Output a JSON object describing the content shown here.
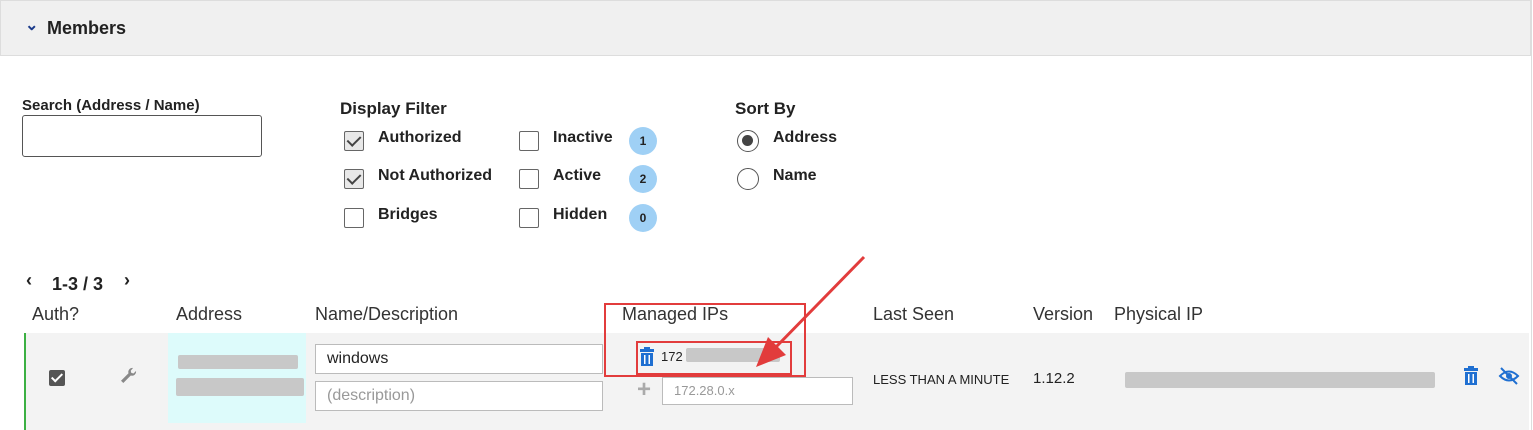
{
  "section": {
    "title": "Members"
  },
  "search": {
    "label": "Search (Address / Name)",
    "value": ""
  },
  "display_filter": {
    "label": "Display Filter",
    "options": [
      {
        "label": "Authorized",
        "checked": true
      },
      {
        "label": "Not Authorized",
        "checked": true
      },
      {
        "label": "Bridges",
        "checked": false
      },
      {
        "label": "Inactive",
        "checked": false,
        "count": "1"
      },
      {
        "label": "Active",
        "checked": false,
        "count": "2"
      },
      {
        "label": "Hidden",
        "checked": false,
        "count": "0"
      }
    ]
  },
  "sort_by": {
    "label": "Sort By",
    "options": [
      {
        "label": "Address",
        "selected": true
      },
      {
        "label": "Name",
        "selected": false
      }
    ]
  },
  "pager": {
    "range": "1-3 / 3"
  },
  "columns": [
    "Auth?",
    "Address",
    "Name/Description",
    "Managed IPs",
    "Last Seen",
    "Version",
    "Physical IP"
  ],
  "member": {
    "authorized": true,
    "name": "windows",
    "description_placeholder": "(description)",
    "managed_ip_prefix": "172",
    "new_ip_placeholder": "172.28.0.x",
    "last_seen": "LESS THAN A MINUTE",
    "version": "1.12.2"
  },
  "colors": {
    "accent": "#1f6fd1",
    "badge": "#9fd0f5",
    "highlight": "#e23c3c",
    "online": "#3cb043"
  }
}
